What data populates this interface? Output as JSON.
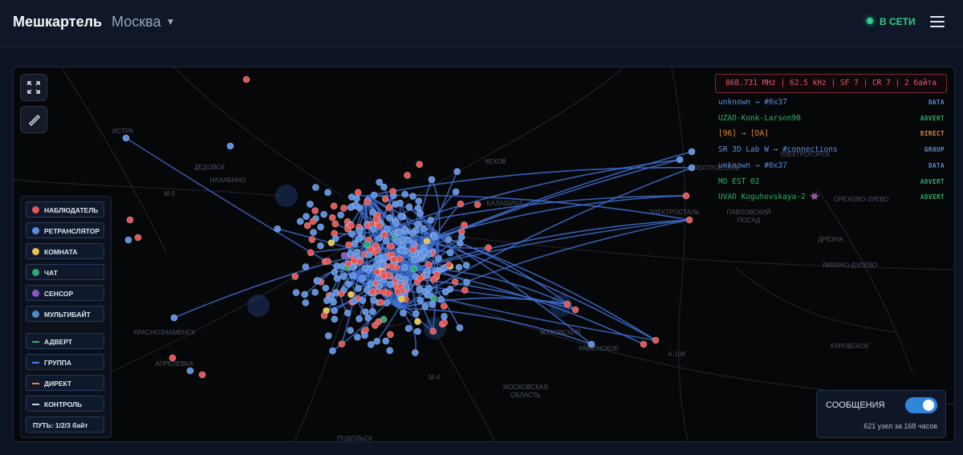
{
  "header": {
    "brand": "Мешкартель",
    "city": "Москва",
    "status": "В СЕТИ"
  },
  "map": {
    "places": [
      "ЕЛЕКТРОСТАЛЬ",
      "ЭЛЕКТРОСТАЛЬ",
      "ПАВЛОВСКИЙ ПОСАД",
      "ИСТРА",
      "ДЕДОВСК",
      "НАХАБИНО",
      "КРАСНОЗНАМЕНСК",
      "АПРЕЛЕВКА",
      "ЖУКОВСКИЙ",
      "РАМЕНСКОЕ",
      "МОСКОВСКАЯ ОБЛАСТЬ",
      "ПОДОЛЬСК",
      "КУРОВСКОЕ",
      "ЛИКИНО-ДУЛЁВО",
      "ДРЕЗНА",
      "ОРЕХОВО-ЗУЕВО",
      "ЗЛЕКТРОГОРСК",
      "БАЛАШИХА",
      "М-5",
      "М-4",
      "А-108",
      "ЧЕХОВ"
    ],
    "node_colors": {
      "observer": "#e45555",
      "repeater": "#5b8fe0",
      "room": "#e6c44a",
      "chat": "#2aa774",
      "sensor": "#8a55c9",
      "multibyte": "#4a8fc5"
    },
    "link_color": "#3f6fd1"
  },
  "legend": {
    "nodes": [
      {
        "label": "НАБЛЮДАТЕЛЬ",
        "color": "#e45555"
      },
      {
        "label": "РЕТРАНСЛЯТОР",
        "color": "#5b8fe0"
      },
      {
        "label": "КОМНАТА",
        "color": "#e6c44a"
      },
      {
        "label": "ЧАТ",
        "color": "#2aa774"
      },
      {
        "label": "СЕНСОР",
        "color": "#8a55c9"
      },
      {
        "label": "МУЛЬТИБАЙТ",
        "color": "#4a8fc5"
      }
    ],
    "links": [
      {
        "label": "АДВЕРТ",
        "color": "#29b36a"
      },
      {
        "label": "ГРУППА",
        "color": "#4b7ee8"
      },
      {
        "label": "ДИРЕКТ",
        "color": "#e38a3a"
      },
      {
        "label": "КОНТРОЛЬ",
        "color": "#c9d2e2"
      }
    ],
    "path": "ПУТЬ: 1/2/3 байт"
  },
  "lora_params": "868.731 MHz | 62.5 kHz | SF 7 | CR 7 | 2 байта",
  "feed": [
    {
      "text": "unknown → #0x37",
      "tag": "DATA",
      "color": "#5b8fe0"
    },
    {
      "text": "UZAO-Konk-Larson90",
      "tag": "ADVERT",
      "color": "#29b36a"
    },
    {
      "text": "[96] → [DA]",
      "tag": "DIRECT",
      "color": "#e38a3a"
    },
    {
      "text": "SR 3D Lab W → #connections",
      "tag": "GROUP",
      "color": "#5b8fe0"
    },
    {
      "text": "unknown → #0x37",
      "tag": "DATA",
      "color": "#5b8fe0"
    },
    {
      "text": "MO EST 02",
      "tag": "ADVERT",
      "color": "#29b36a"
    },
    {
      "text": "UVAO Koguhovskaya-2 👾",
      "tag": "ADVERT",
      "color": "#29b36a"
    }
  ],
  "messages": {
    "title": "СООБЩЕНИЯ",
    "enabled": true,
    "stat": "621 узел за 168 часов"
  }
}
